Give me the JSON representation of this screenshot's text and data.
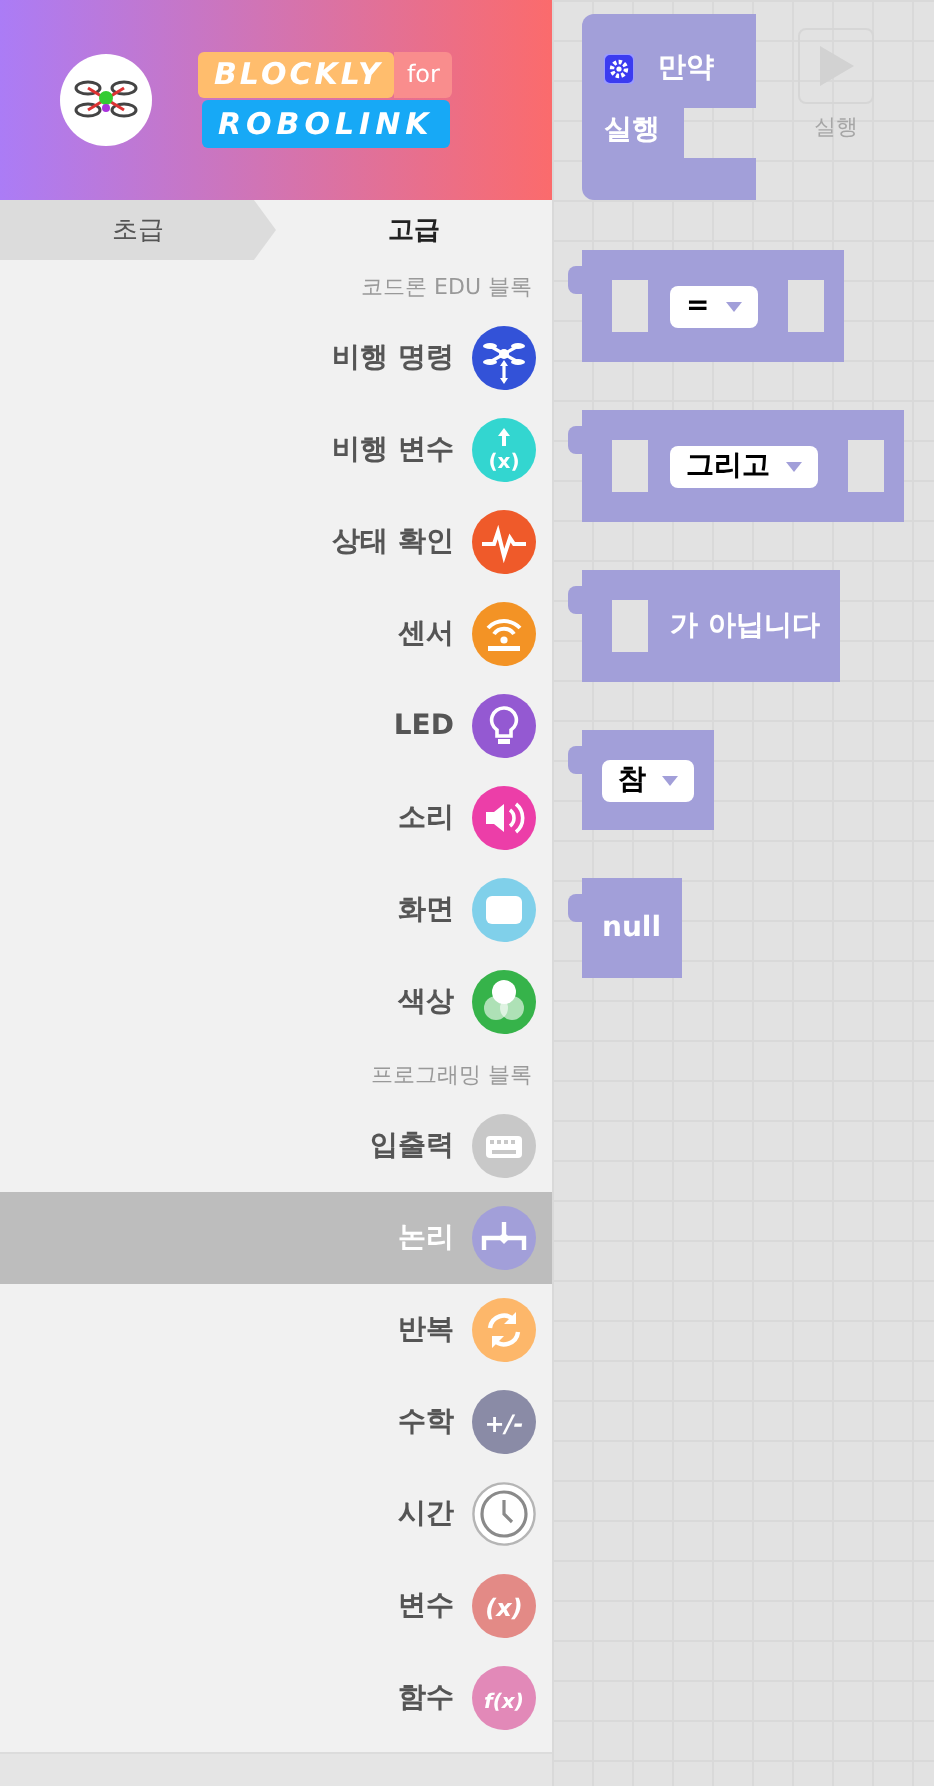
{
  "header": {
    "logo_top": "BLOCKLY",
    "logo_for": "for",
    "logo_bottom": "ROBOLINK"
  },
  "tabs": [
    {
      "label": "초급",
      "selected": false
    },
    {
      "label": "고급",
      "selected": true
    }
  ],
  "sections": [
    {
      "heading": "코드론 EDU 블록",
      "items": [
        {
          "label": "비행 명령",
          "kind": "drone",
          "color": "#3352d8",
          "selected": false
        },
        {
          "label": "비행 변수",
          "kind": "variable-up",
          "color": "#33d6d0",
          "glyph": "(x)",
          "selected": false
        },
        {
          "label": "상태 확인",
          "kind": "pulse",
          "color": "#ef5a2a",
          "selected": false
        },
        {
          "label": "센서",
          "kind": "sensor",
          "color": "#f39325",
          "selected": false
        },
        {
          "label": "LED",
          "kind": "bulb",
          "color": "#9459d2",
          "selected": false
        },
        {
          "label": "소리",
          "kind": "speaker",
          "color": "#ec3ea8",
          "selected": false
        },
        {
          "label": "화면",
          "kind": "screen",
          "color": "#80d0ea",
          "selected": false
        },
        {
          "label": "색상",
          "kind": "circles",
          "color": "#36b34a",
          "selected": false
        }
      ]
    },
    {
      "heading": "프로그래밍 블록",
      "items": [
        {
          "label": "입출력",
          "kind": "keyboard",
          "color": "#c8c8c8",
          "selected": false
        },
        {
          "label": "논리",
          "kind": "logic",
          "color": "#a29fd9",
          "selected": true
        },
        {
          "label": "반복",
          "kind": "loop",
          "color": "#fdb76a",
          "selected": false
        },
        {
          "label": "수학",
          "kind": "text",
          "color": "#8a8ba6",
          "glyph": "+/-",
          "selected": false
        },
        {
          "label": "시간",
          "kind": "clock",
          "color": "#ffffff",
          "selected": false
        },
        {
          "label": "변수",
          "kind": "text",
          "color": "#e38a86",
          "glyph": "(x)",
          "selected": false
        },
        {
          "label": "함수",
          "kind": "text",
          "color": "#e289b8",
          "glyph": "f(x)",
          "selected": false
        }
      ]
    }
  ],
  "run_button": {
    "label": "실행",
    "disabled": true
  },
  "blocks": [
    {
      "kind": "if",
      "label": "만약",
      "label2": "실행"
    },
    {
      "kind": "compare",
      "value": "="
    },
    {
      "kind": "compare",
      "value": "그리고"
    },
    {
      "kind": "not",
      "label": "가 아닙니다"
    },
    {
      "kind": "value",
      "value": "참"
    },
    {
      "kind": "text",
      "label": "null"
    }
  ]
}
